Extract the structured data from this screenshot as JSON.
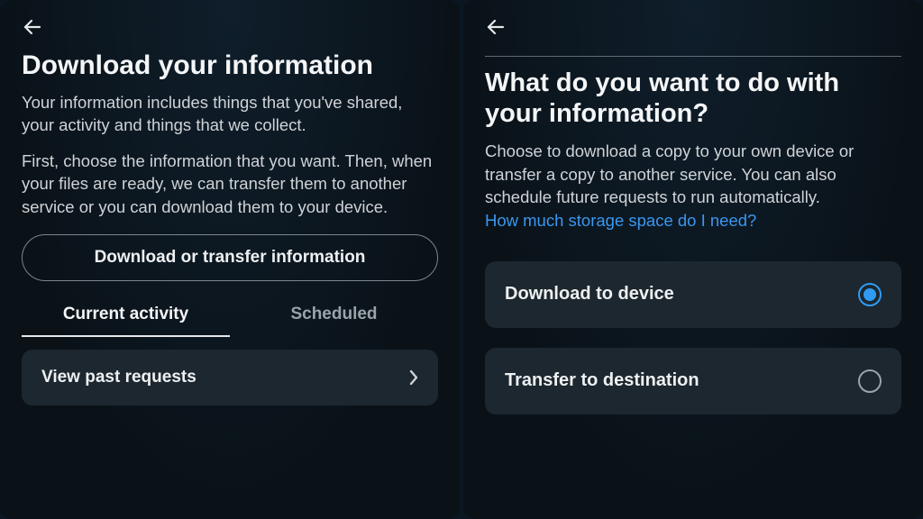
{
  "left": {
    "title": "Download your information",
    "para1": "Your information includes things that you've shared, your activity and things that we collect.",
    "para2": "First, choose the information that you want. Then, when your files are ready, we can transfer them to another service or you can download them to your device.",
    "primary_button": "Download or transfer information",
    "tabs": {
      "current": "Current activity",
      "scheduled": "Scheduled"
    },
    "view_past": "View past requests"
  },
  "right": {
    "title": "What do you want to do with your information?",
    "para": "Choose to download a copy to your own device or transfer a copy to another service. You can also schedule future requests to run automatically.",
    "link": "How much storage space do I need?",
    "options": {
      "download": "Download to device",
      "transfer": "Transfer to destination"
    }
  }
}
